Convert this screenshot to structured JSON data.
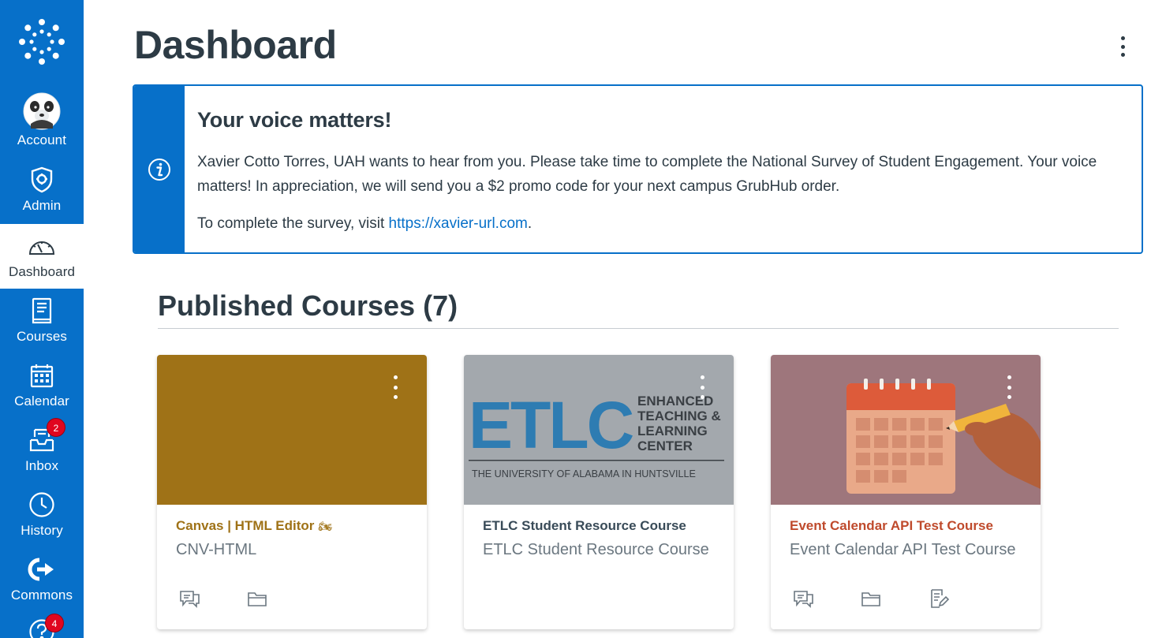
{
  "nav": {
    "items": [
      {
        "label": "Account",
        "icon": "avatar"
      },
      {
        "label": "Admin",
        "icon": "shield-icon"
      },
      {
        "label": "Dashboard",
        "icon": "speedometer-icon",
        "active": true
      },
      {
        "label": "Courses",
        "icon": "book-icon"
      },
      {
        "label": "Calendar",
        "icon": "calendar-icon"
      },
      {
        "label": "Inbox",
        "icon": "inbox-icon",
        "badge": "2"
      },
      {
        "label": "History",
        "icon": "clock-icon"
      },
      {
        "label": "Commons",
        "icon": "commons-icon"
      },
      {
        "label": "Help",
        "icon": "help-icon",
        "badge": "4"
      }
    ]
  },
  "header": {
    "title": "Dashboard"
  },
  "alert": {
    "title": "Your voice matters!",
    "body": "Xavier Cotto Torres, UAH wants to hear from you. Please take time to complete the National Survey of Student Engagement. Your voice matters! In appreciation, we will send you a $2 promo code for your next campus GrubHub order.",
    "cta_prefix": "To complete the survey, visit ",
    "link_text": "https://xavier-url.com",
    "cta_suffix": "."
  },
  "courses_section": {
    "title": "Published Courses (7)"
  },
  "courses": [
    {
      "name": "Canvas | HTML Editor",
      "code": "CNV-HTML",
      "color": "#9f7217",
      "emoji": "🏍",
      "icons": [
        "discussions-icon",
        "folder-icon"
      ]
    },
    {
      "name": "ETLC Student Resource Course",
      "code": "ETLC Student Resource Course",
      "color": "#394b58",
      "hero": {
        "logo_text": "ETLC",
        "line1": "ENHANCED",
        "line2": "TEACHING &",
        "line3": "LEARNING",
        "line4": "CENTER",
        "footer": "THE UNIVERSITY OF ALABAMA IN HUNTSVILLE"
      },
      "icons": []
    },
    {
      "name": "Event Calendar API Test Course",
      "code": "Event Calendar API Test Course",
      "color": "#bf4a2c",
      "icons": [
        "discussions-icon",
        "folder-icon",
        "assignment-icon"
      ]
    }
  ],
  "colors": {
    "brand": "#0770c9",
    "text": "#2d3b45",
    "badge": "#e0061f"
  }
}
